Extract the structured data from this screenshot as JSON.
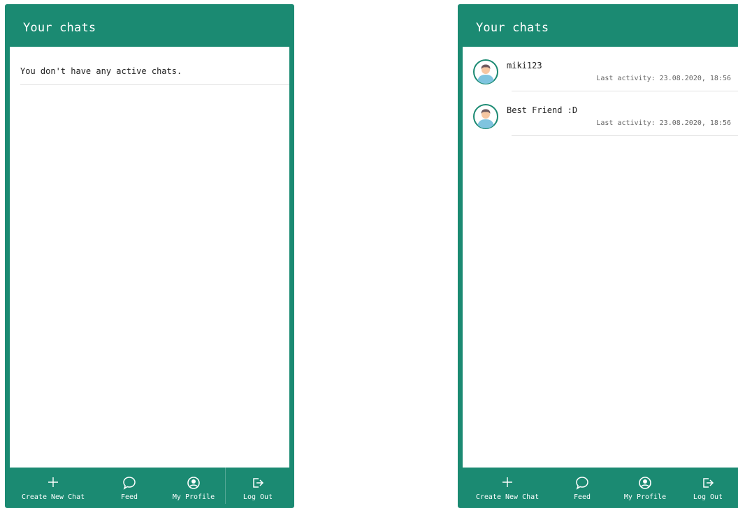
{
  "colors": {
    "brand": "#1b8a72",
    "panel": "#ffffff"
  },
  "left_screen": {
    "title": "Your chats",
    "empty_message": "You don't have any active chats.",
    "nav": [
      {
        "label": "Create New Chat",
        "icon": "plus-icon"
      },
      {
        "label": "Feed",
        "icon": "chat-bubble-icon"
      },
      {
        "label": "My Profile",
        "icon": "user-circle-icon"
      },
      {
        "label": "Log Out",
        "icon": "logout-icon"
      }
    ]
  },
  "right_screen": {
    "title": "Your chats",
    "chats": [
      {
        "name": "miki123",
        "activity": "Last activity: 23.08.2020, 18:56",
        "icon": "avatar-icon"
      },
      {
        "name": "Best Friend :D",
        "activity": "Last activity: 23.08.2020, 18:56",
        "icon": "avatar-icon"
      }
    ],
    "nav": [
      {
        "label": "Create New Chat",
        "icon": "plus-icon"
      },
      {
        "label": "Feed",
        "icon": "chat-bubble-icon"
      },
      {
        "label": "My Profile",
        "icon": "user-circle-icon"
      },
      {
        "label": "Log Out",
        "icon": "logout-icon"
      }
    ]
  }
}
